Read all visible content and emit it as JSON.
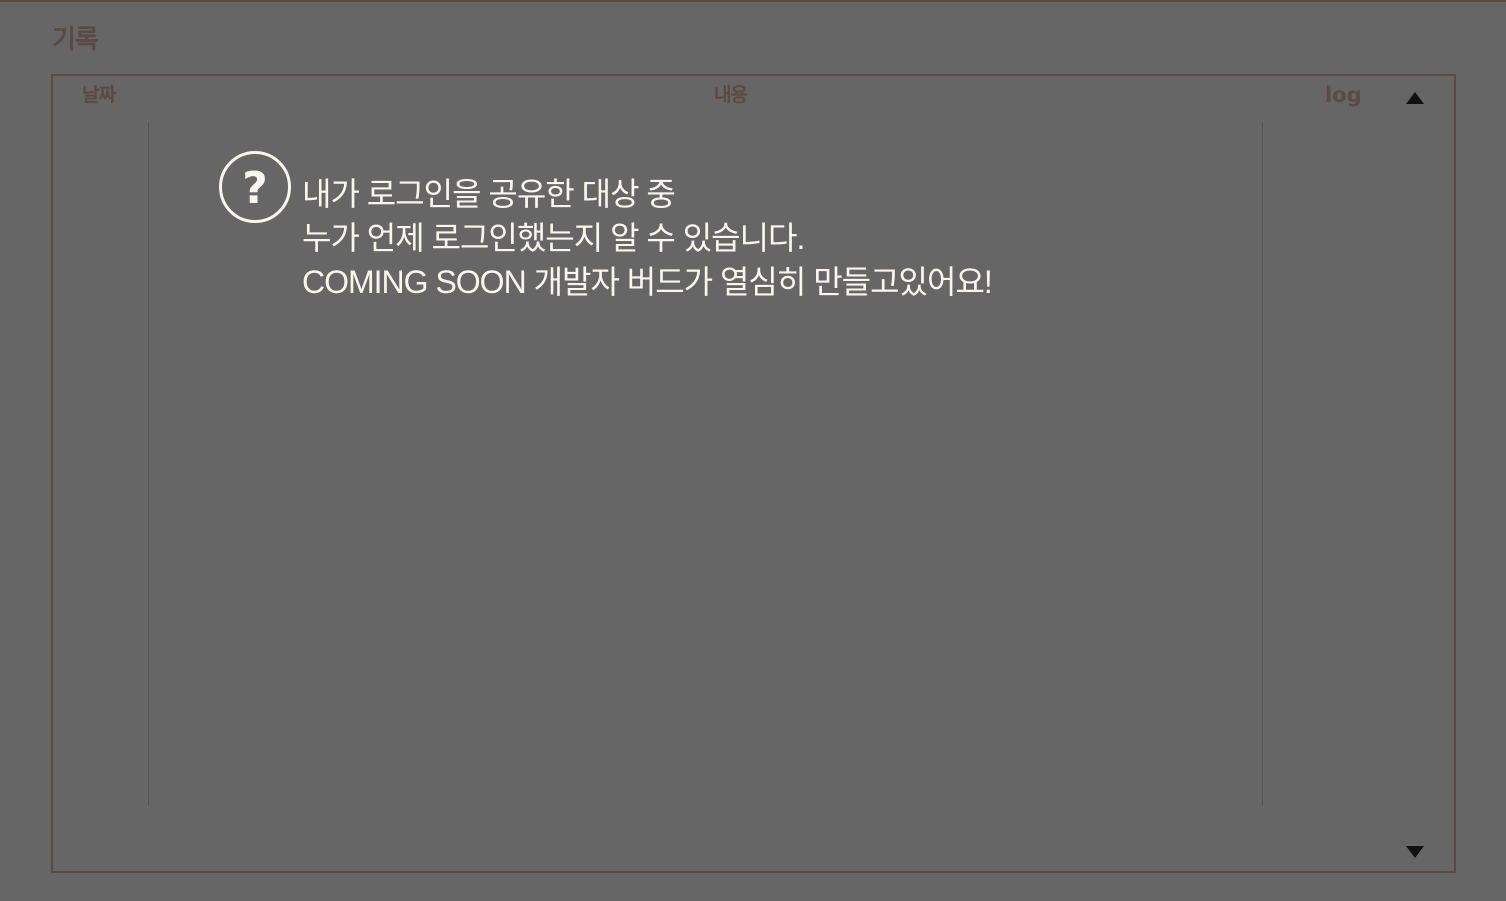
{
  "section": {
    "title": "기록"
  },
  "table": {
    "headers": {
      "date": "날짜",
      "content": "내용",
      "log": "log"
    }
  },
  "notice": {
    "icon": "question-circle-icon",
    "lines": [
      "내가 로그인을 공유한 대상 중",
      "누가 언제 로그인했는지 알 수 있습니다.",
      "COMING SOON 개발자 버드가 열심히 만들고있어요!"
    ]
  },
  "colors": {
    "background": "#666666",
    "accent": "#5a4a46",
    "notice_text": "#f8f6ee"
  },
  "scroll": {
    "up_icon": "triangle-up-icon",
    "down_icon": "triangle-down-icon"
  }
}
